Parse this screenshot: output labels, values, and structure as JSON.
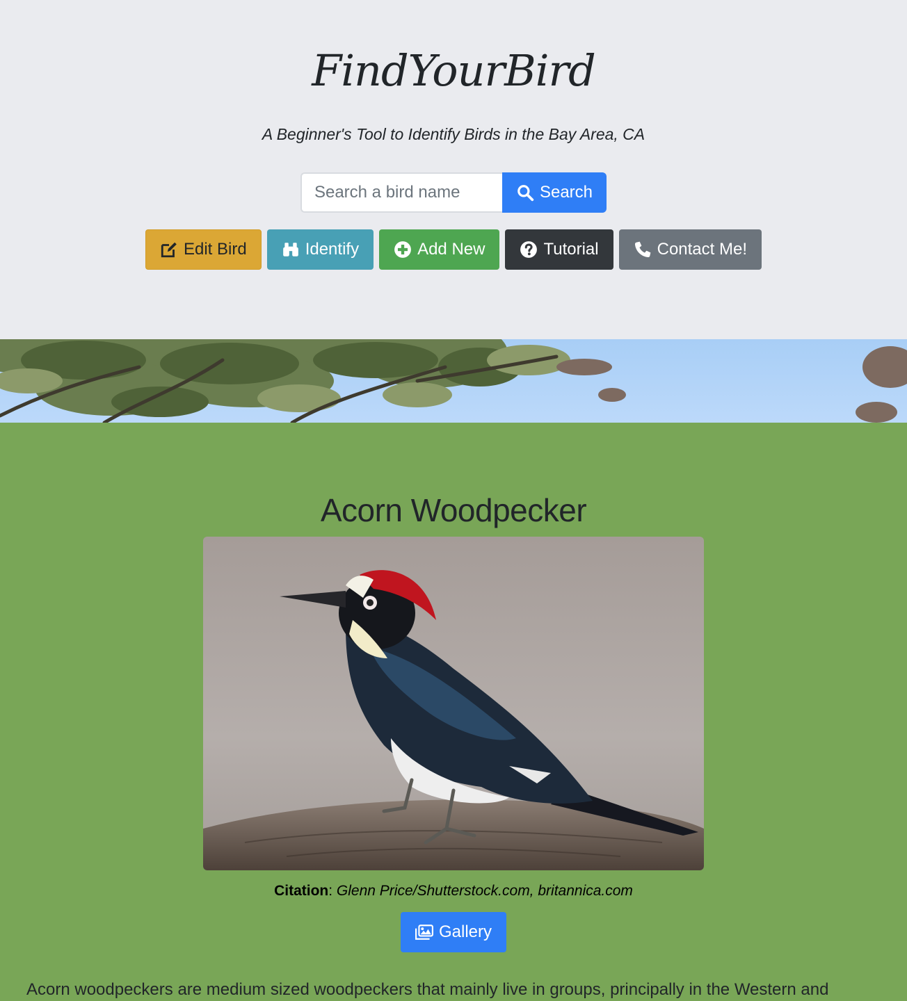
{
  "header": {
    "title": "FindYourBird",
    "tagline": "A Beginner's Tool to Identify Birds in the Bay Area, CA"
  },
  "search": {
    "placeholder": "Search a bird name",
    "value": "",
    "button_label": "Search",
    "button_icon": "search-icon"
  },
  "actions": [
    {
      "label": "Edit Bird",
      "icon": "edit-icon",
      "color": "#dba735"
    },
    {
      "label": "Identify",
      "icon": "binoculars-icon",
      "color": "#48a0b5"
    },
    {
      "label": "Add New",
      "icon": "plus-circle-icon",
      "color": "#4ea651"
    },
    {
      "label": "Tutorial",
      "icon": "question-circle-icon",
      "color": "#33373b"
    },
    {
      "label": "Contact Me!",
      "icon": "phone-icon",
      "color": "#6c747c"
    }
  ],
  "bird": {
    "name": "Acorn Woodpecker",
    "citation_label": "Citation",
    "citation_text": "Glenn Price/Shutterstock.com, britannica.com",
    "gallery_label": "Gallery",
    "gallery_icon": "images-icon",
    "description": "Acorn woodpeckers are medium sized woodpeckers that mainly live in groups, principally in the Western and"
  },
  "colors": {
    "hero_bg": "#eaebef",
    "content_bg": "#79a657",
    "primary": "#2f7ef6"
  }
}
